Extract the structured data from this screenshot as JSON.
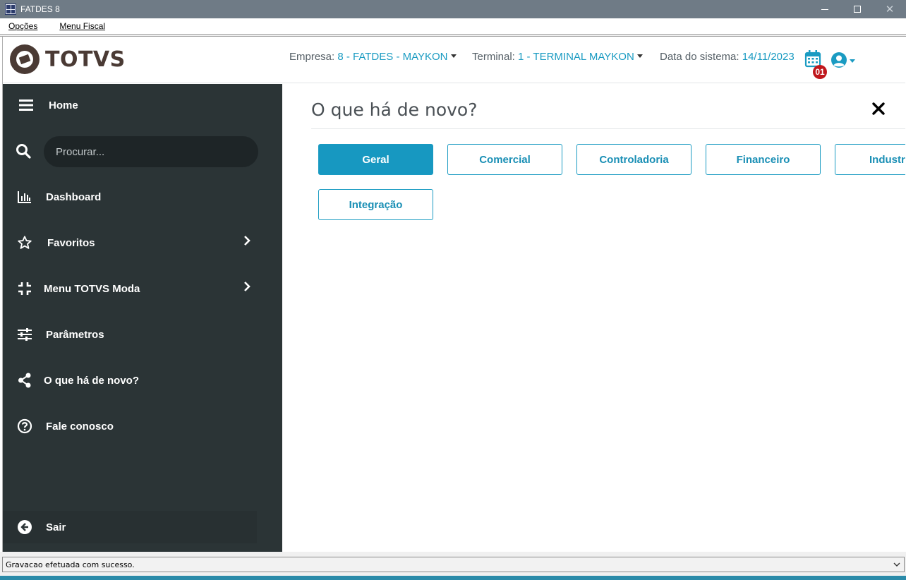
{
  "window": {
    "title": "FATDES 8",
    "close_glyph": "✕"
  },
  "menubar": {
    "items": [
      {
        "label": "Opções"
      },
      {
        "label": "Menu Fiscal"
      }
    ]
  },
  "header": {
    "logo_text": "TOTVS",
    "empresa_label": "Empresa:",
    "empresa_value": "8 - FATDES - MAYKON",
    "terminal_label": "Terminal:",
    "terminal_value": "1 - TERMINAL MAYKON",
    "data_label": "Data do sistema:",
    "data_value": "14/11/2023",
    "notification_count": "01",
    "accent_color": "#1a9bc2",
    "badge_color": "#c0171c"
  },
  "sidebar": {
    "home_label": "Home",
    "search_placeholder": "Procurar...",
    "items": [
      {
        "label": "Dashboard",
        "icon": "bar-chart-icon"
      },
      {
        "label": "Favoritos",
        "icon": "star-icon",
        "has_children": true
      },
      {
        "label": "Menu TOTVS Moda",
        "icon": "compress-icon",
        "has_children": true
      },
      {
        "label": "Parâmetros",
        "icon": "sliders-icon"
      },
      {
        "label": "O que há de novo?",
        "icon": "share-icon"
      },
      {
        "label": "Fale conosco",
        "icon": "question-circle-icon"
      }
    ],
    "logout_label": "Sair",
    "background_color": "#2b3436"
  },
  "main": {
    "title": "O que há de novo?",
    "tabs": [
      {
        "label": "Geral",
        "active": true
      },
      {
        "label": "Comercial",
        "active": false
      },
      {
        "label": "Controladoria",
        "active": false
      },
      {
        "label": "Financeiro",
        "active": false
      },
      {
        "label": "Industria",
        "active": false
      },
      {
        "label": "Integração",
        "active": false
      }
    ]
  },
  "statusbar": {
    "message": "Gravacao efetuada com sucesso."
  }
}
